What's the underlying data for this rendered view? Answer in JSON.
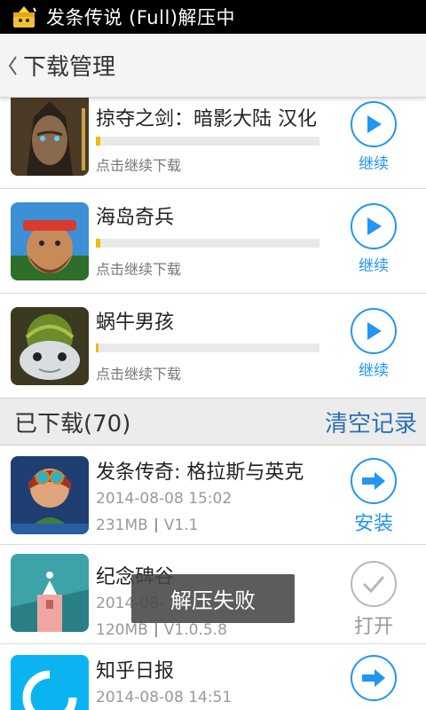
{
  "status_bar": {
    "title": "发条传说 (Full)解压中",
    "icon": "package-notification-icon"
  },
  "header": {
    "back_icon": "chevron-left-icon",
    "title": "下载管理"
  },
  "downloading": [
    {
      "name": "掠夺之剑：暗影大陆 汉化",
      "status": "点击继续下载",
      "progress": 0.02,
      "action": "继续",
      "icon": "play-icon"
    },
    {
      "name": "海岛奇兵",
      "status": "点击继续下载",
      "progress": 0.02,
      "action": "继续",
      "icon": "play-icon"
    },
    {
      "name": "蜗牛男孩",
      "status": "点击继续下载",
      "progress": 0.01,
      "action": "继续",
      "icon": "play-icon"
    }
  ],
  "downloaded_section": {
    "title": "已下载(70)",
    "clear_label": "清空记录"
  },
  "downloaded": [
    {
      "name": "发条传奇: 格拉斯与英克",
      "date": "2014-08-08 15:02",
      "size": "231MB",
      "version": "V1.1",
      "action": "安装",
      "icon": "arrow-right-icon"
    },
    {
      "name": "纪念碑谷",
      "date": "2014-08-",
      "size": "120MB",
      "version": "V1.0.5.8",
      "action": "打开",
      "icon": "check-icon"
    },
    {
      "name": "知乎日报",
      "date": "2014-08-08 14:51",
      "size": "",
      "version": "",
      "action": "",
      "icon": "arrow-right-icon"
    }
  ],
  "toast": {
    "text": "解压失败"
  },
  "colors": {
    "accent": "#2196f3",
    "link": "#2a6fb6",
    "progress": "#f5b800",
    "status_bar": "#000000"
  }
}
